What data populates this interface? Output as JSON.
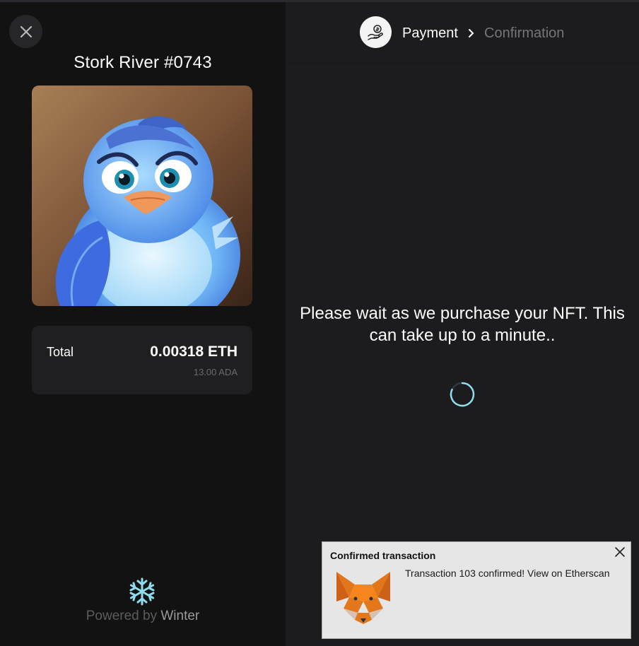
{
  "nft": {
    "title": "Stork River #0743"
  },
  "totals": {
    "label": "Total",
    "eth": "0.00318 ETH",
    "ada": "13.00 ADA"
  },
  "footer": {
    "powered_prefix": "Powered by",
    "brand": "Winter"
  },
  "steps": {
    "payment": "Payment",
    "confirmation": "Confirmation"
  },
  "status": {
    "message": "Please wait as we purchase your NFT. This can take up to a minute.."
  },
  "notification": {
    "title": "Confirmed transaction",
    "message": "Transaction 103 confirmed! View on Etherscan"
  },
  "icons": {
    "close": "close-icon",
    "payment": "hand-coin-icon",
    "chevron": "chevron-right-icon",
    "spinner": "loading-spinner-icon",
    "brand_logo": "snowflake-icon",
    "wallet": "metamask-fox-icon"
  },
  "colors": {
    "left_bg": "#121212",
    "right_bg": "#1c1c1e",
    "card_bg": "#1f1f21",
    "accent": "#8fdcec",
    "muted_text": "#75757a"
  }
}
